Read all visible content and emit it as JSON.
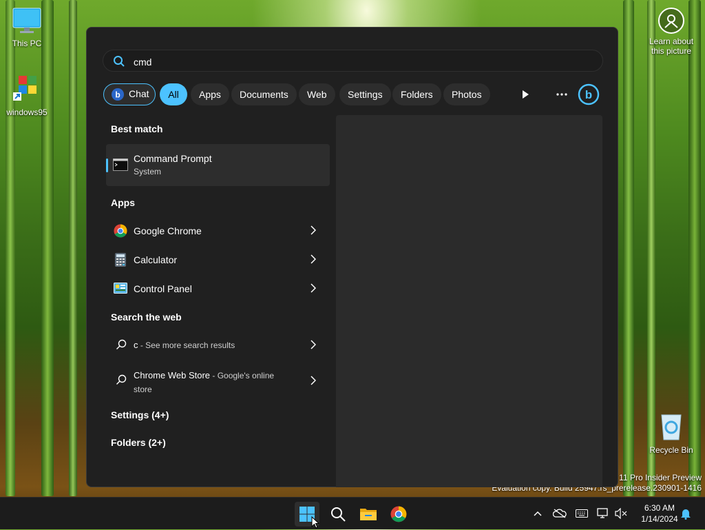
{
  "desktop": {
    "icons": [
      {
        "label": "This PC"
      },
      {
        "label": "windows95"
      },
      {
        "label": "Recycle Bin"
      }
    ],
    "learn_about": "Learn about this picture",
    "watermark_line1": "s 11 Pro Insider Preview",
    "watermark_line2": "Evaluation copy. Build 25947.rs_prerelease.230901-1416"
  },
  "search": {
    "query": "cmd",
    "filters": [
      "Chat",
      "All",
      "Apps",
      "Documents",
      "Web",
      "Settings",
      "Folders",
      "Photos"
    ],
    "active_filter": "All",
    "best_match_heading": "Best match",
    "best_match": {
      "title": "Command Prompt",
      "subtitle": "System"
    },
    "apps_heading": "Apps",
    "apps": [
      {
        "label": "Google Chrome",
        "icon": "chrome-icon"
      },
      {
        "label": "Calculator",
        "icon": "calculator-icon"
      },
      {
        "label": "Control Panel",
        "icon": "control-panel-icon"
      }
    ],
    "web_heading": "Search the web",
    "web_results": [
      {
        "label": "c",
        "suffix": " - See more search results"
      },
      {
        "label": "Chrome Web Store",
        "suffix": " - Google's online",
        "suffix2": "store"
      }
    ],
    "settings_heading": "Settings (4+)",
    "folders_heading": "Folders (2+)"
  },
  "taskbar": {
    "time": "6:30 AM",
    "date": "1/14/2024"
  },
  "colors": {
    "accent": "#4cc2ff",
    "panel": "#202020"
  }
}
